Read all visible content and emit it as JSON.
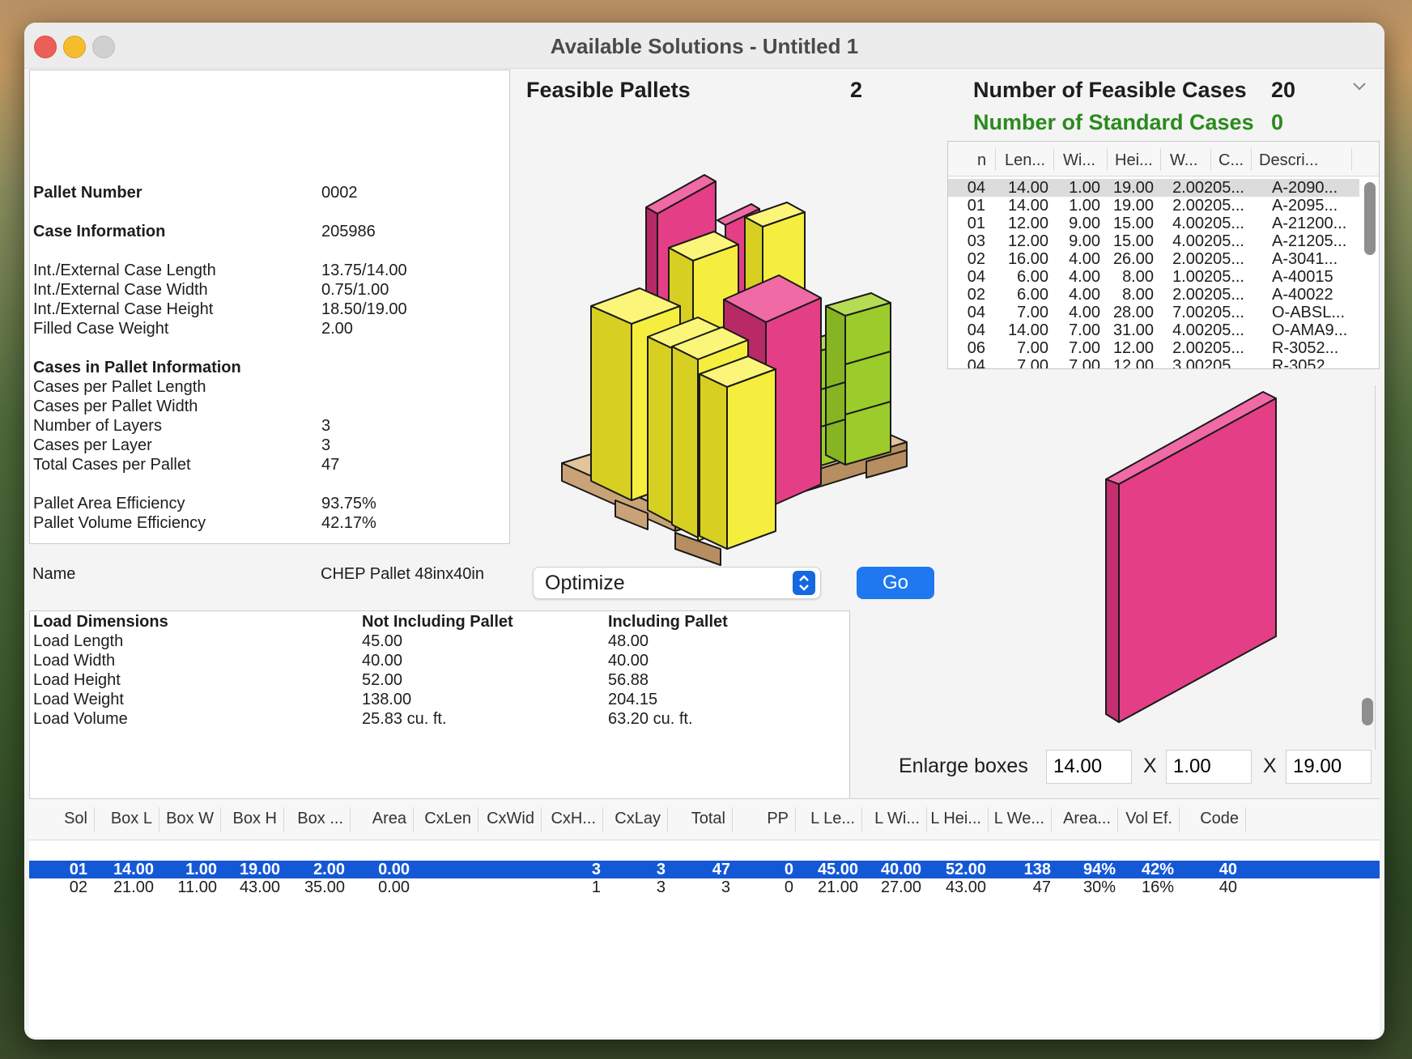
{
  "window": {
    "title": "Available Solutions - Untitled 1"
  },
  "info": {
    "pallet_number_label": "Pallet Number",
    "pallet_number": "0002",
    "case_info_label": "Case Information",
    "case_info": "205986",
    "rows": [
      {
        "label": "Int./External Case Length",
        "value": "13.75/14.00"
      },
      {
        "label": "Int./External Case Width",
        "value": "0.75/1.00"
      },
      {
        "label": "Int./External Case Height",
        "value": "18.50/19.00"
      },
      {
        "label": "Filled Case Weight",
        "value": "2.00"
      }
    ],
    "cases_in_pallet_label": "Cases in Pallet Information",
    "pallet_rows": [
      {
        "label": "Cases per Pallet Length",
        "value": ""
      },
      {
        "label": "Cases per Pallet Width",
        "value": ""
      },
      {
        "label": "Number of Layers",
        "value": "3"
      },
      {
        "label": "Cases per Layer",
        "value": "3"
      },
      {
        "label": "Total Cases per Pallet",
        "value": "47"
      }
    ],
    "eff_rows": [
      {
        "label": "Pallet Area Efficiency",
        "value": "93.75%"
      },
      {
        "label": "Pallet Volume Efficiency",
        "value": "42.17%"
      }
    ],
    "name_label": "Name",
    "name": "CHEP Pallet 48inx40in"
  },
  "load": {
    "headers": [
      "Load Dimensions",
      "Not Including Pallet",
      "Including Pallet"
    ],
    "rows": [
      [
        "Load Length",
        "45.00",
        "48.00"
      ],
      [
        "Load Width",
        "40.00",
        "40.00"
      ],
      [
        "Load Height",
        "52.00",
        "56.88"
      ],
      [
        "Load Weight",
        "138.00",
        "204.15"
      ],
      [
        "Load Volume",
        "25.83 cu. ft.",
        "63.20 cu. ft."
      ]
    ]
  },
  "feasible": {
    "pallets_label": "Feasible Pallets",
    "pallets": "2",
    "cases_label": "Number of Feasible Cases",
    "cases": "20",
    "standard_label": "Number of Standard Cases",
    "standard": "0"
  },
  "cases_table": {
    "headers": [
      "n",
      "Len...",
      "Wi...",
      "Hei...",
      "W...",
      "C...",
      "Descri..."
    ],
    "rows": [
      [
        "04",
        "14.00",
        "1.00",
        "19.00",
        "2.00",
        "205...",
        "A-2090..."
      ],
      [
        "01",
        "14.00",
        "1.00",
        "19.00",
        "2.00",
        "205...",
        "A-2095..."
      ],
      [
        "01",
        "12.00",
        "9.00",
        "15.00",
        "4.00",
        "205...",
        "A-21200..."
      ],
      [
        "03",
        "12.00",
        "9.00",
        "15.00",
        "4.00",
        "205...",
        "A-21205..."
      ],
      [
        "02",
        "16.00",
        "4.00",
        "26.00",
        "2.00",
        "205...",
        "A-3041..."
      ],
      [
        "04",
        "6.00",
        "4.00",
        "8.00",
        "1.00",
        "205...",
        "A-40015"
      ],
      [
        "02",
        "6.00",
        "4.00",
        "8.00",
        "2.00",
        "205...",
        "A-40022"
      ],
      [
        "04",
        "7.00",
        "4.00",
        "28.00",
        "7.00",
        "205...",
        "O-ABSL..."
      ],
      [
        "04",
        "14.00",
        "7.00",
        "31.00",
        "4.00",
        "205...",
        "O-AMA9..."
      ],
      [
        "06",
        "7.00",
        "7.00",
        "12.00",
        "2.00",
        "205...",
        "R-3052..."
      ],
      [
        "04",
        "7.00",
        "7.00",
        "12.00",
        "3.00",
        "205...",
        "R-3052..."
      ]
    ]
  },
  "controls": {
    "optimize": "Optimize",
    "go": "Go",
    "enlarge_label": "Enlarge boxes",
    "dim1": "14.00",
    "dim2": "1.00",
    "dim3": "19.00",
    "x": "X"
  },
  "solutions": {
    "headers": [
      "Sol",
      "Box L",
      "Box W",
      "Box H",
      "Box ...",
      "Area",
      "CxLen",
      "CxWid",
      "CxH...",
      "CxLay",
      "Total",
      "PP",
      "L Le...",
      "L Wi...",
      "L Hei...",
      "L We...",
      "Area...",
      "Vol Ef.",
      "Code"
    ],
    "rows": [
      [
        "01",
        "14.00",
        "1.00",
        "19.00",
        "2.00",
        "0.00",
        "",
        "",
        "3",
        "3",
        "47",
        "0",
        "45.00",
        "40.00",
        "52.00",
        "138",
        "94%",
        "42%",
        "40"
      ],
      [
        "02",
        "21.00",
        "11.00",
        "43.00",
        "35.00",
        "0.00",
        "",
        "",
        "1",
        "3",
        "3",
        "0",
        "21.00",
        "27.00",
        "43.00",
        "47",
        "30%",
        "16%",
        "40"
      ]
    ]
  },
  "colors": {
    "accent": "#0f5fd6",
    "green": "#2b8a1e",
    "pink": "#e43f86",
    "yellow": "#f6ee3e",
    "lime": "#9ccc2c",
    "wood": "#e3c39a"
  }
}
